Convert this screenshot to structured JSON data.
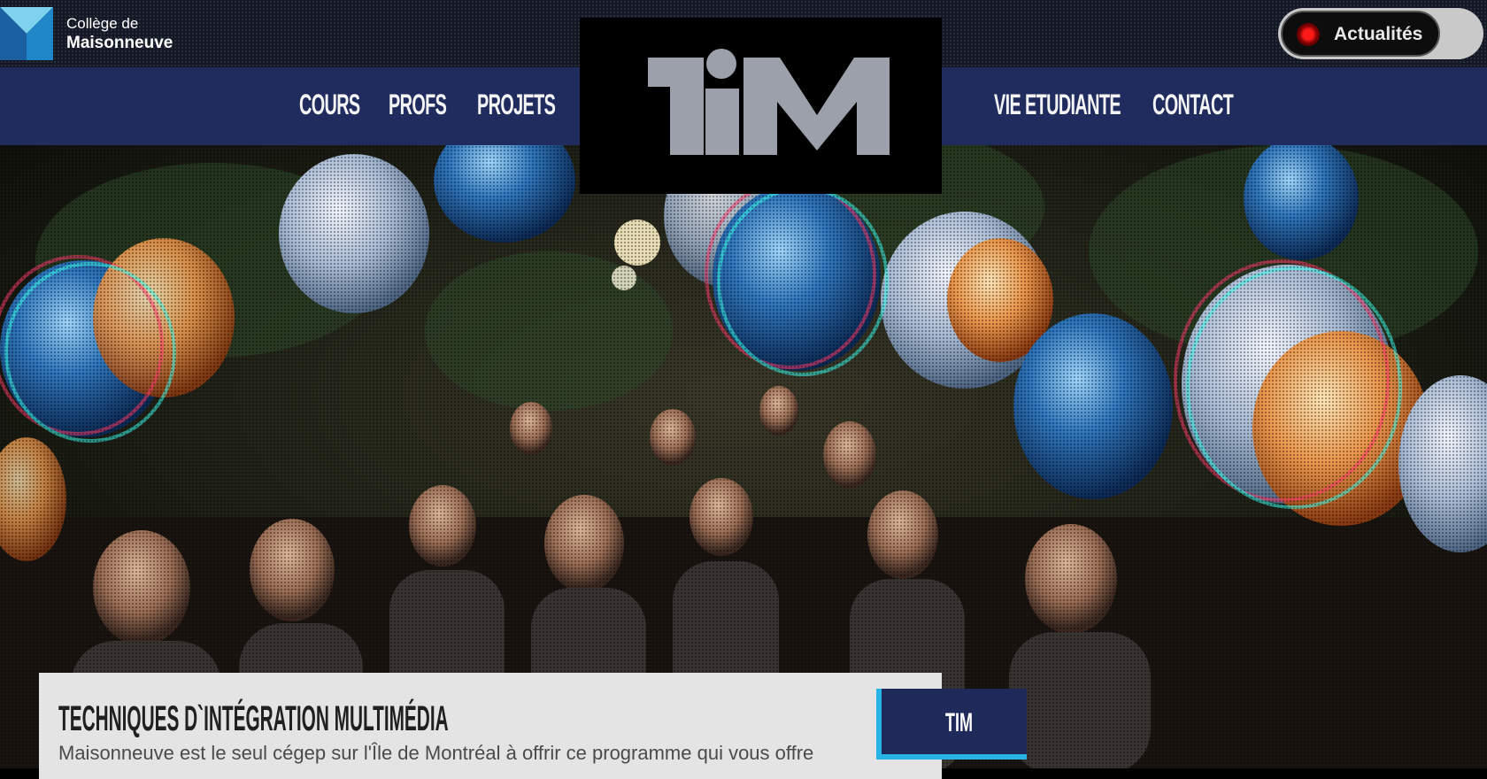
{
  "header": {
    "college_line1": "Collège de",
    "college_line2": "Maisonneuve",
    "news_toggle_label": "Actualités"
  },
  "nav": {
    "items": [
      {
        "label": "COURS"
      },
      {
        "label": "PROFS"
      },
      {
        "label": "PROJETS"
      },
      {
        "label": "VIE ETUDIANTE"
      },
      {
        "label": "CONTACT"
      }
    ]
  },
  "logo": {
    "text": "TIM",
    "color": "#9ba0ab",
    "background": "#000000"
  },
  "hero": {
    "image": "party-crowd-with-balloons"
  },
  "info": {
    "title": "TECHNIQUES D`INTÉGRATION MULTIMÉDIA",
    "description": "Maisonneuve est le seul cégep sur l'Île de Montréal à offrir ce programme qui vous offre",
    "button_label": "TIM"
  },
  "colors": {
    "nav_background": "#202c5e",
    "accent": "#27b4e6",
    "card_background": "#e4e4e4"
  }
}
